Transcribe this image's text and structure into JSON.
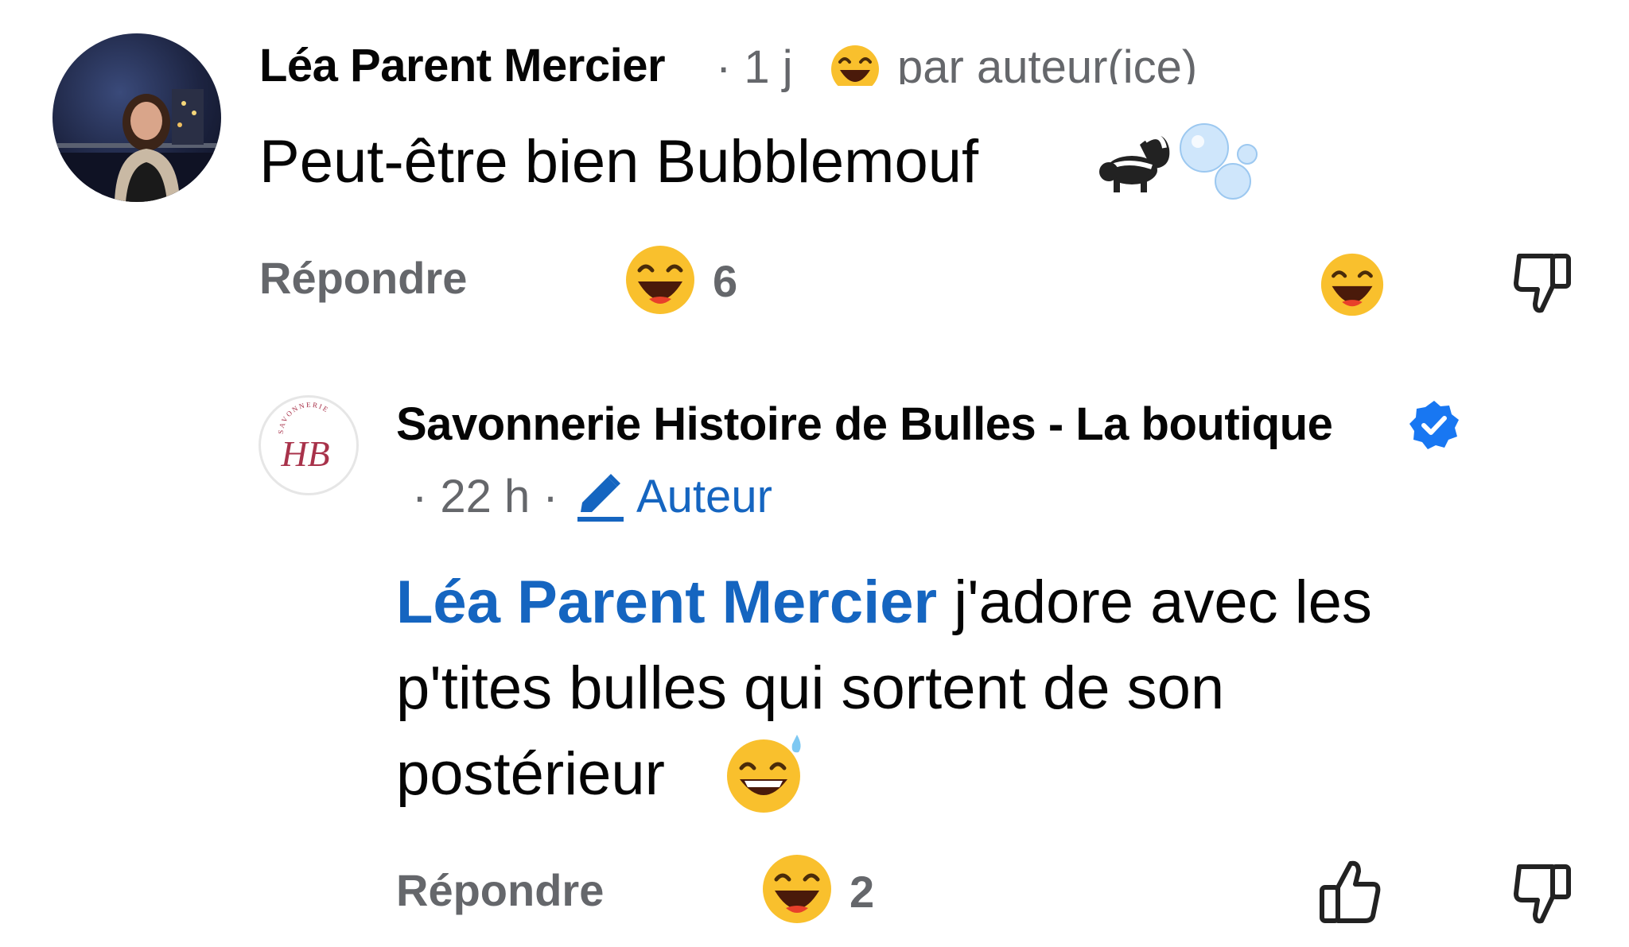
{
  "comment": {
    "author": "Léa Parent Mercier",
    "time": "· 1 j",
    "badge_label": "par auteur(ice)",
    "text": "Peut-être bien Bubblemouf",
    "text_emojis": "🦨🫧",
    "reply_label": "Répondre",
    "reaction_count": "6"
  },
  "reply": {
    "author": "Savonnerie Histoire de Bulles - La boutique",
    "logo_text": "SAVONNERIE",
    "logo_initials": "HB",
    "time": "· 22 h ·",
    "author_tag": "Auteur",
    "mention": "Léa Parent Mercier",
    "text_line1": " j'adore avec les",
    "text_line2": "p'tites bulles qui sortent de son",
    "text_line3": "postérieur",
    "reply_label": "Répondre",
    "reaction_count": "2"
  },
  "colors": {
    "link": "#1565c0",
    "muted": "#65676b",
    "verified": "#1877f2"
  },
  "icons": [
    "laughing-emoji",
    "skunk-emoji",
    "bubbles-emoji",
    "thumbs-down-icon",
    "thumbs-up-icon",
    "verified-badge-icon",
    "pencil-icon",
    "sweat-smile-emoji"
  ]
}
